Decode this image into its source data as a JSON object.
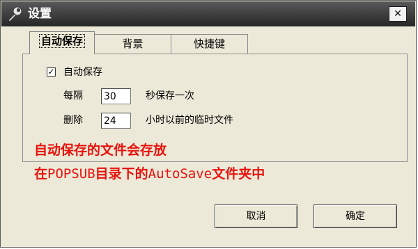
{
  "window": {
    "title": "设置",
    "title_icon": "wrench-icon",
    "close_glyph": "✕"
  },
  "tabs": [
    {
      "label": "自动保存",
      "active": true
    },
    {
      "label": "背景",
      "active": false
    },
    {
      "label": "快捷键",
      "active": false
    }
  ],
  "autosave": {
    "enabled": true,
    "checkbox_label": "自动保存",
    "interval_prefix": "每隔",
    "interval_value": "30",
    "interval_suffix": "秒保存一次",
    "delete_prefix": "删除",
    "delete_value": "24",
    "delete_suffix": "小时以前的临时文件"
  },
  "note": {
    "line1": "自动保存的文件会存放",
    "line2_a": "在",
    "line2_b": "POPSUB",
    "line2_c": "目录下的",
    "line2_d": "AutoSave",
    "line2_e": "文件夹中",
    "color": "#e8120c"
  },
  "buttons": {
    "cancel": "取消",
    "ok": "确定"
  }
}
